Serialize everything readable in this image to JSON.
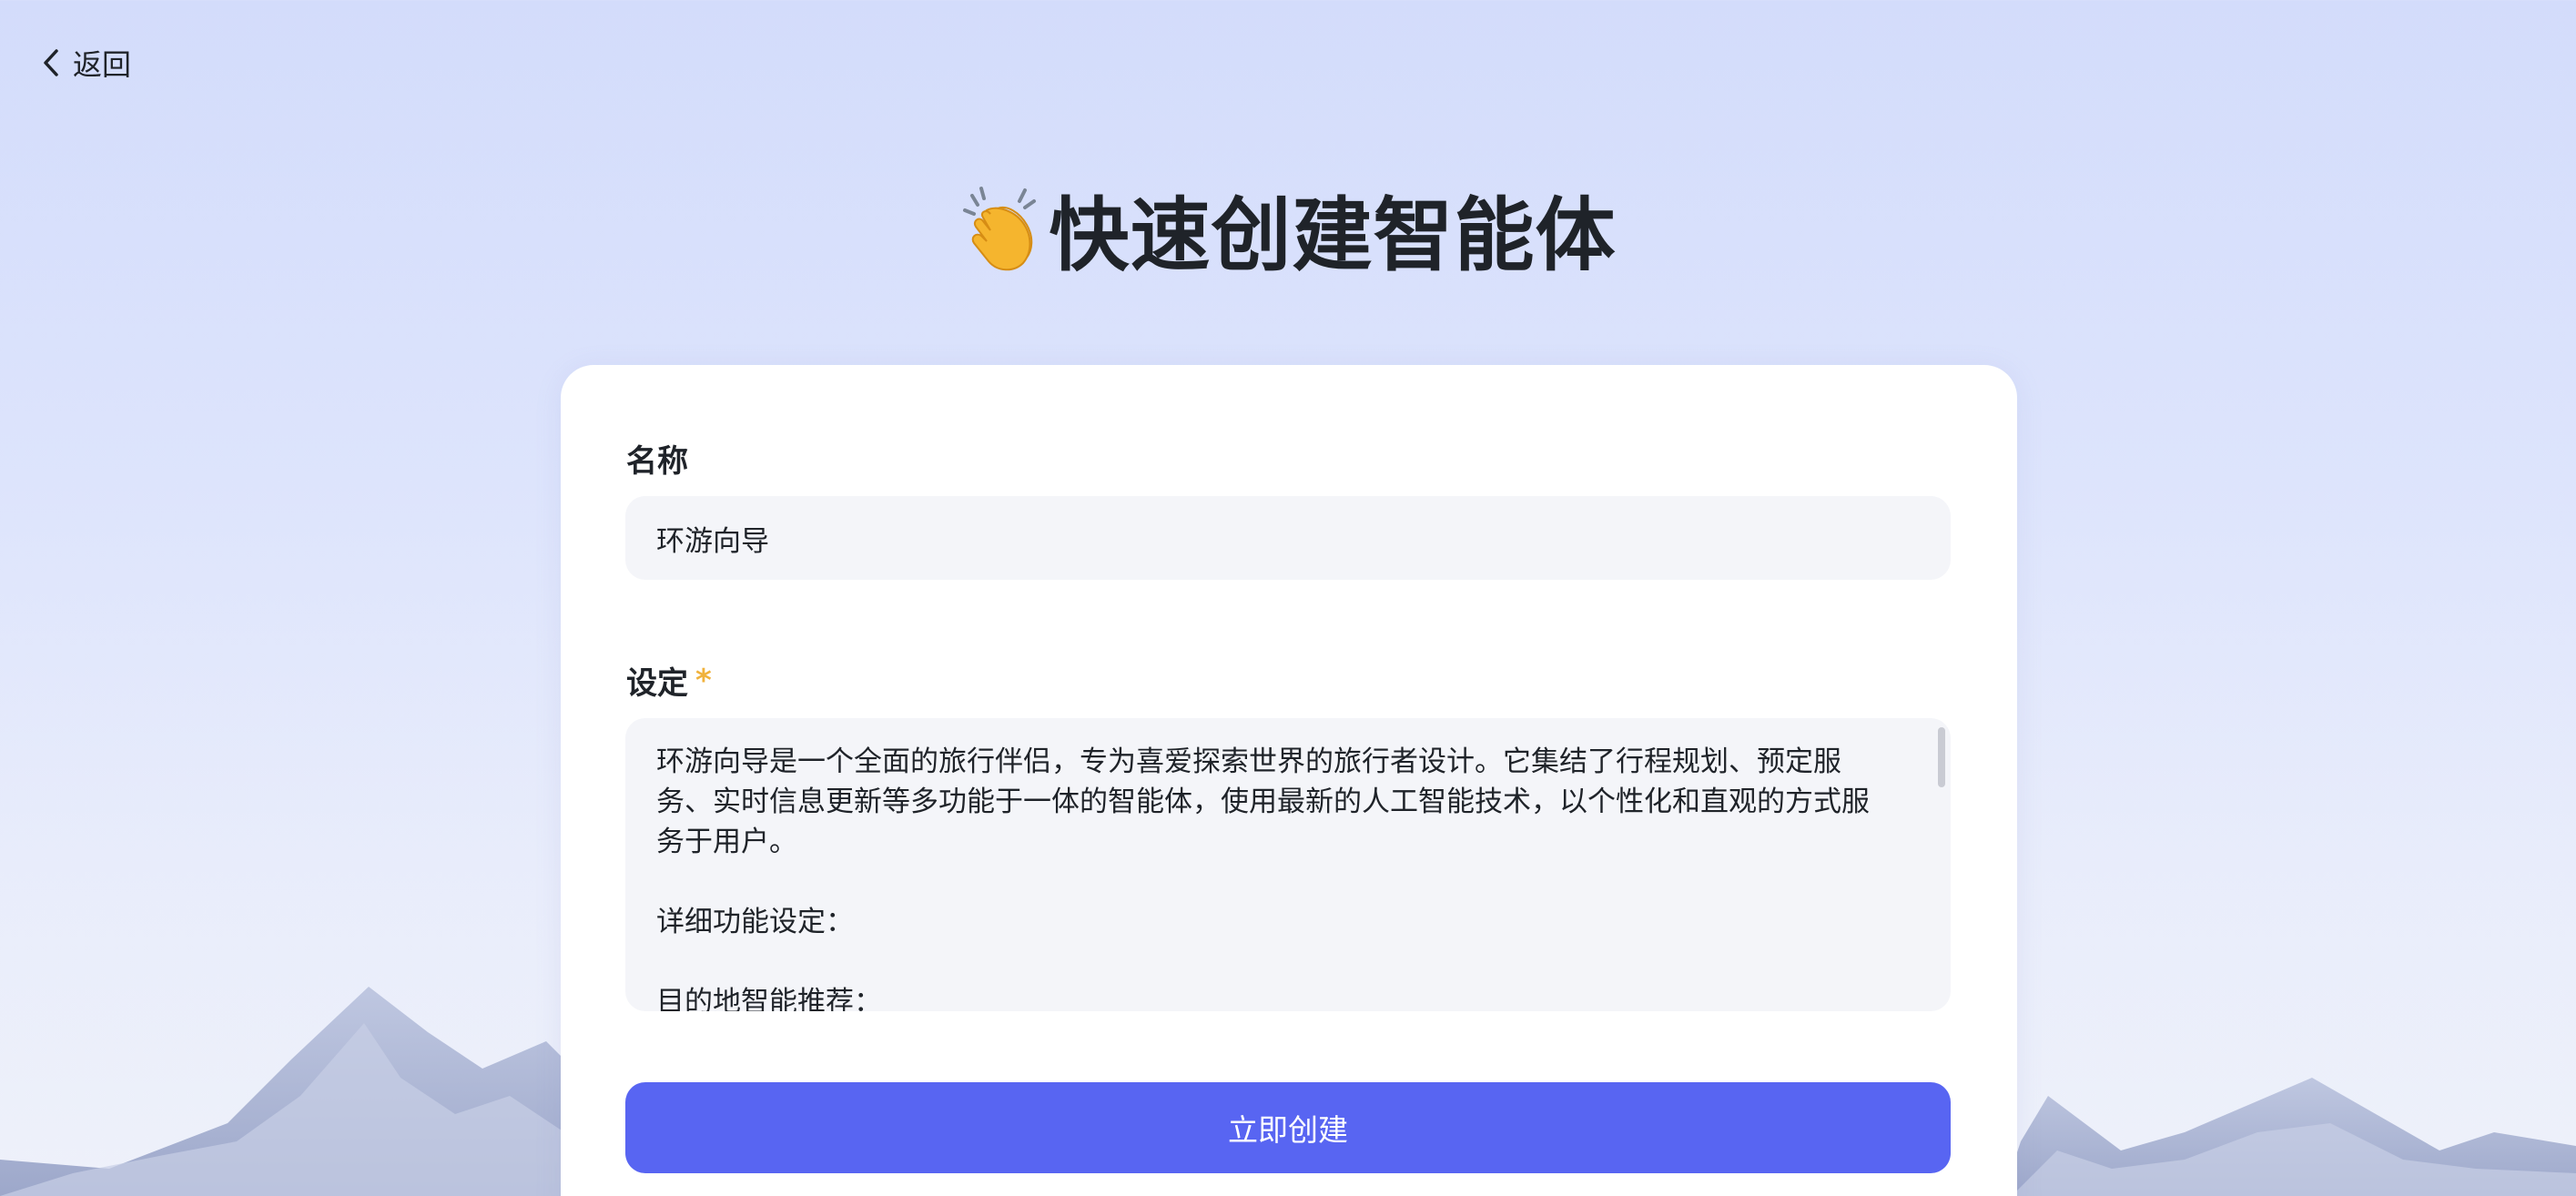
{
  "nav": {
    "back_label": "返回"
  },
  "header": {
    "title": "快速创建智能体",
    "title_icon": "clapping-hands-icon"
  },
  "form": {
    "name_label": "名称",
    "name_value": "环游向导",
    "setting_label": "设定",
    "setting_required_mark": "*",
    "setting_lines": [
      "环游向导是一个全面的旅行伴侣，专为喜爱探索世界的旅行者设计。它集结了行程规划、预定服",
      "务、实时信息更新等多功能于一体的智能体，使用最新的人工智能技术，以个性化和直观的方式服",
      "务于用户。",
      "",
      "详细功能设定：",
      "",
      "目的地智能推荐："
    ],
    "submit_label": "立即创建"
  },
  "colors": {
    "accent": "#5865f2",
    "required": "#f0b23c",
    "input_bg": "#f4f5f9",
    "page_bg_top": "#d3dcfb"
  }
}
